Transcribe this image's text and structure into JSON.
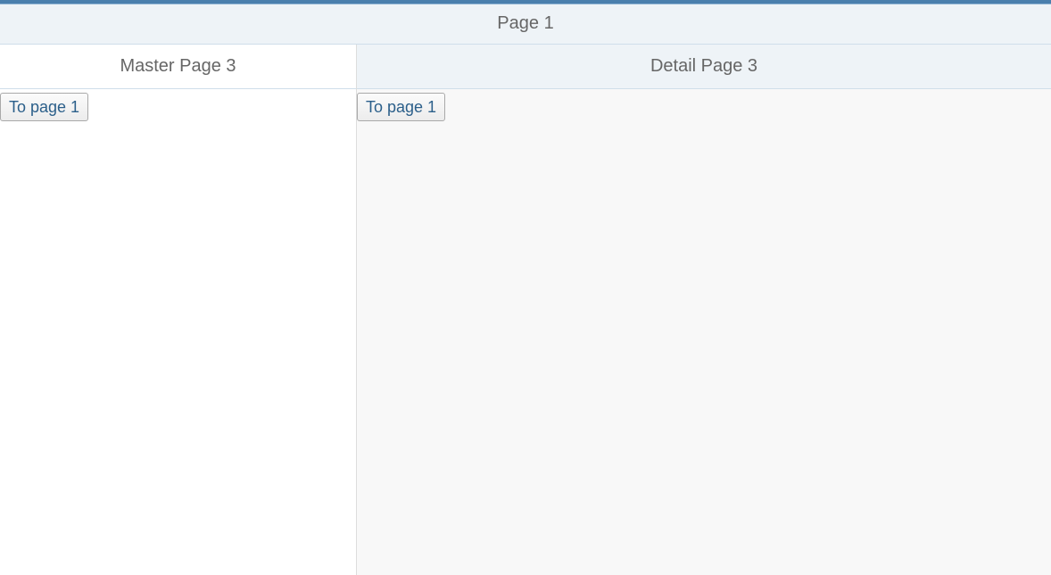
{
  "app": {
    "title": "Page 1",
    "accent_color": "#4a7fad"
  },
  "master": {
    "title": "Master Page 3",
    "button_label": "To page 1"
  },
  "detail": {
    "title": "Detail Page 3",
    "button_label": "To page 1"
  },
  "colors": {
    "header_bg": "#eef3f7",
    "title_text": "#666666",
    "button_text": "#2b5f8a",
    "detail_bg": "#f8f8f8"
  }
}
